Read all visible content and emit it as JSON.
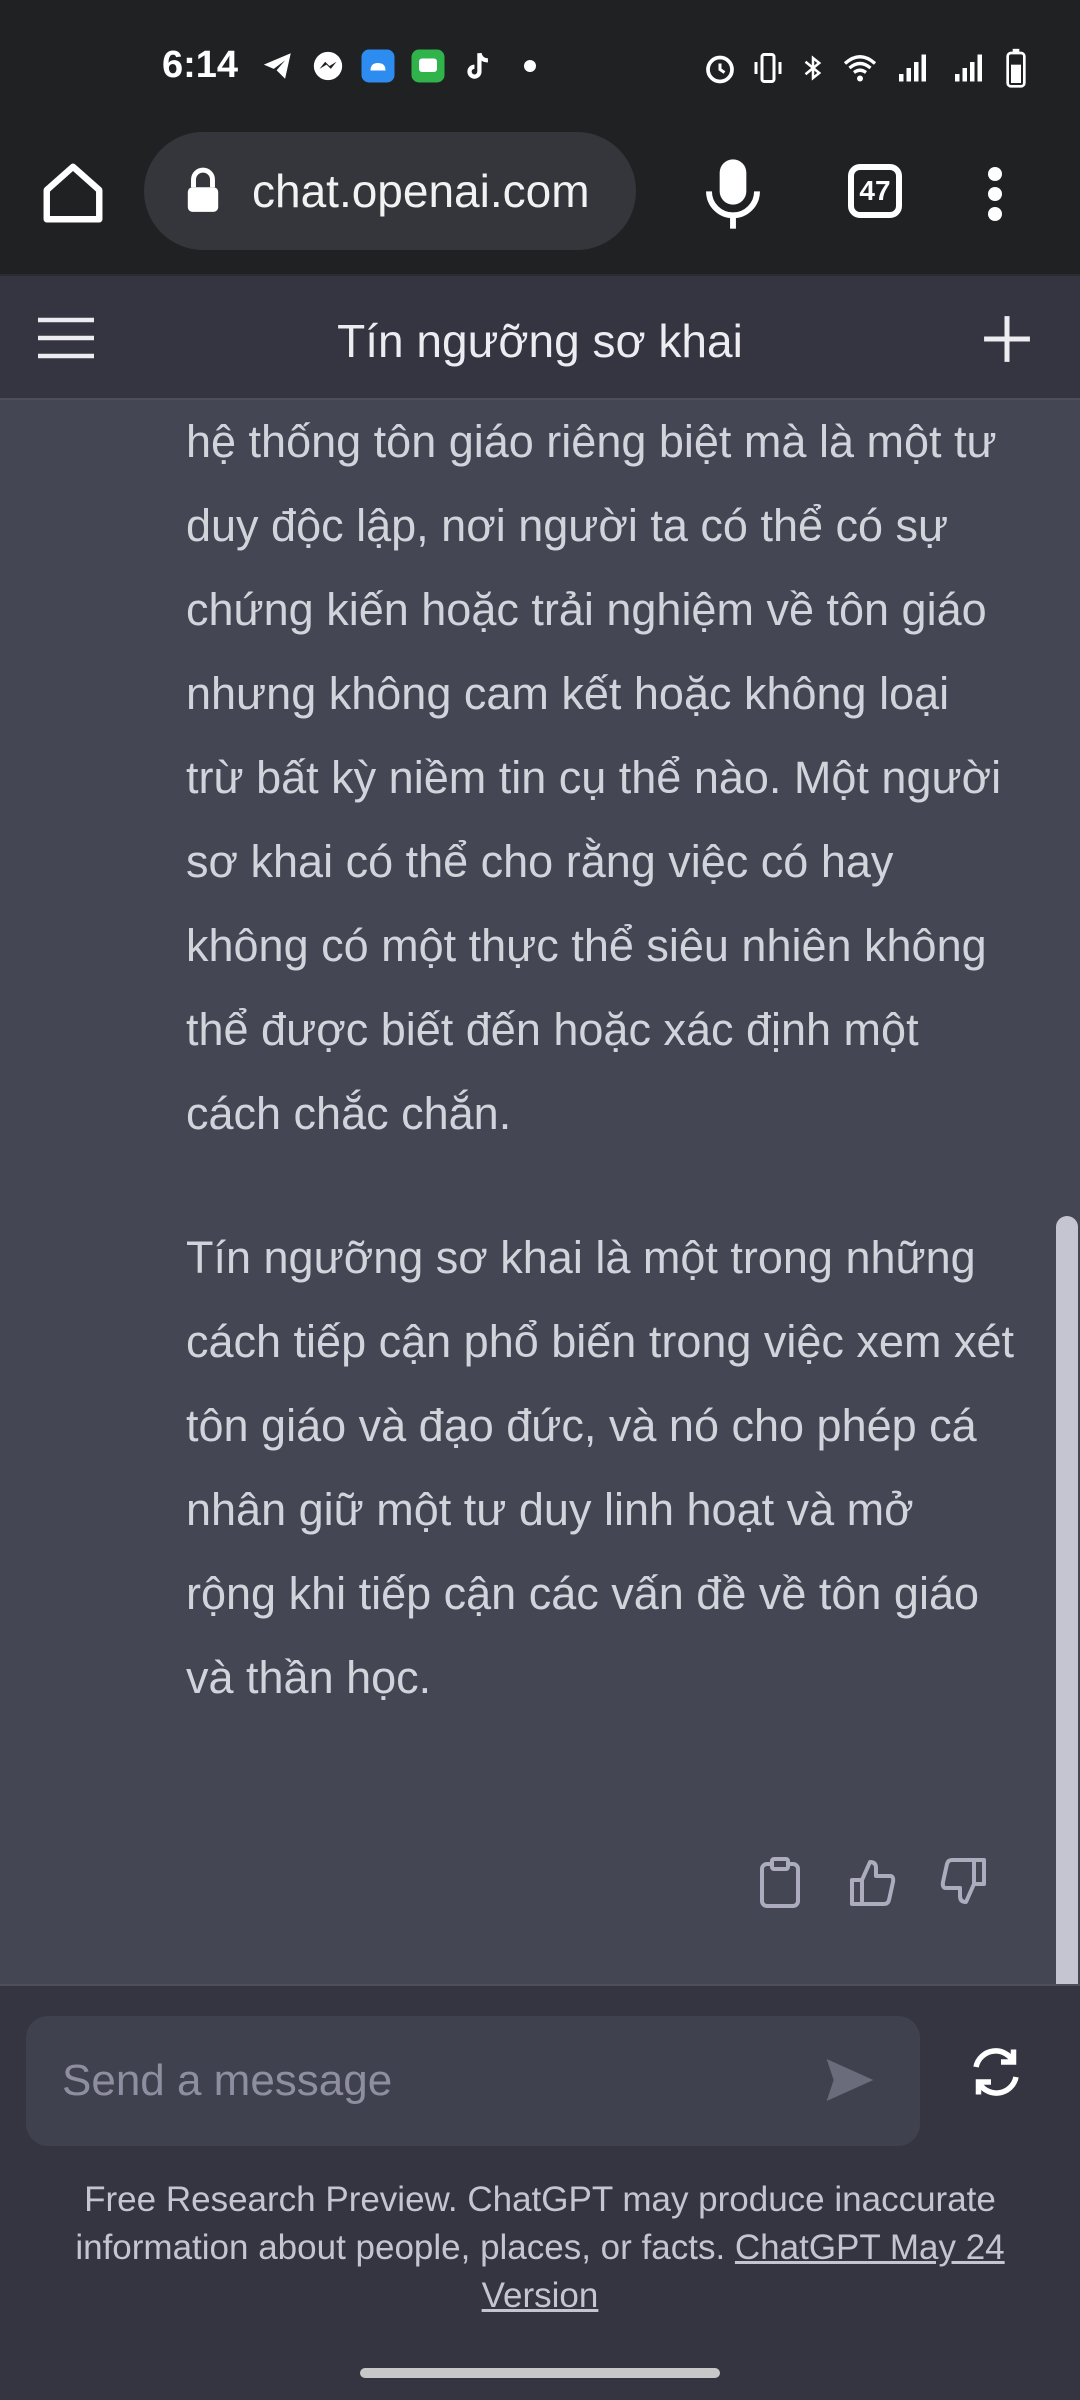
{
  "status_bar": {
    "time": "6:14"
  },
  "browser": {
    "url": "chat.openai.com",
    "tab_count": "47"
  },
  "chat": {
    "title": "Tín ngưỡng sơ khai"
  },
  "message": {
    "paragraphs": [
      "hệ thống tôn giáo riêng biệt mà là một tư duy độc lập, nơi người ta có thể có sự chứng kiến hoặc trải nghiệm về tôn giáo nhưng không cam kết hoặc không loại trừ bất kỳ niềm tin cụ thể nào. Một người sơ khai có thể cho rằng việc có hay không có một thực thể siêu nhiên không thể được biết đến hoặc xác định một cách chắc chắn.",
      "Tín ngưỡng sơ khai là một trong những cách tiếp cận phổ biến trong việc xem xét tôn giáo và đạo đức, và nó cho phép cá nhân giữ một tư duy linh hoạt và mở rộng khi tiếp cận các vấn đề về tôn giáo và thần học."
    ]
  },
  "composer": {
    "placeholder": "Send a message"
  },
  "footer": {
    "disclaimer": "Free Research Preview. ChatGPT may produce inaccurate information about people, places, or facts.",
    "version_link": "ChatGPT May 24 Version"
  },
  "colors": {
    "browser_bg": "#202123",
    "chat_bg": "#444654",
    "header_bg": "#343541",
    "input_bg": "#40414f"
  }
}
